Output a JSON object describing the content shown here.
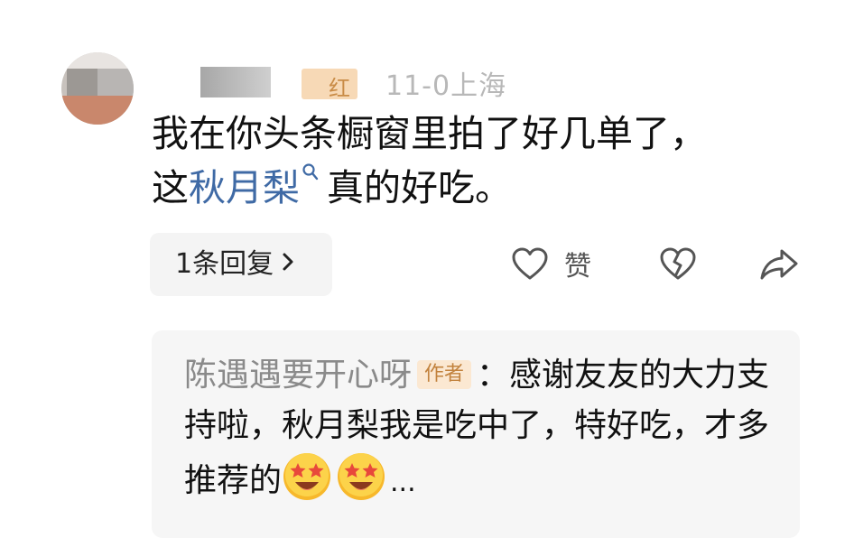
{
  "comment": {
    "location": "上海",
    "level_badge": "红",
    "time": "11-0",
    "text_line1": "我在你头条橱窗里拍了好几单了，",
    "text_line2_prefix": "这",
    "keyword": "秋月梨",
    "text_line2_suffix": "真的好吃。"
  },
  "actions": {
    "replies_label": "1条回复",
    "like_label": "赞",
    "icons": [
      "heart-outline-icon",
      "broken-heart-icon",
      "share-arrow-icon",
      "chevron-right-icon",
      "search-icon"
    ]
  },
  "reply": {
    "author_name": "陈遇遇要开心呀",
    "author_badge": "作者",
    "separator": "：",
    "text": "感谢友友的大力支持啦，秋月梨我是吃中了，特好吃，才多推荐的",
    "emoji_names": [
      "star-eyes-emoji",
      "star-eyes-emoji"
    ],
    "trailing": "..."
  },
  "colors": {
    "keyword": "#3f6aa5",
    "badge_text": "#c2823d",
    "badge_bg": "#fbe8d2",
    "reply_box_bg": "#f6f6f6"
  }
}
